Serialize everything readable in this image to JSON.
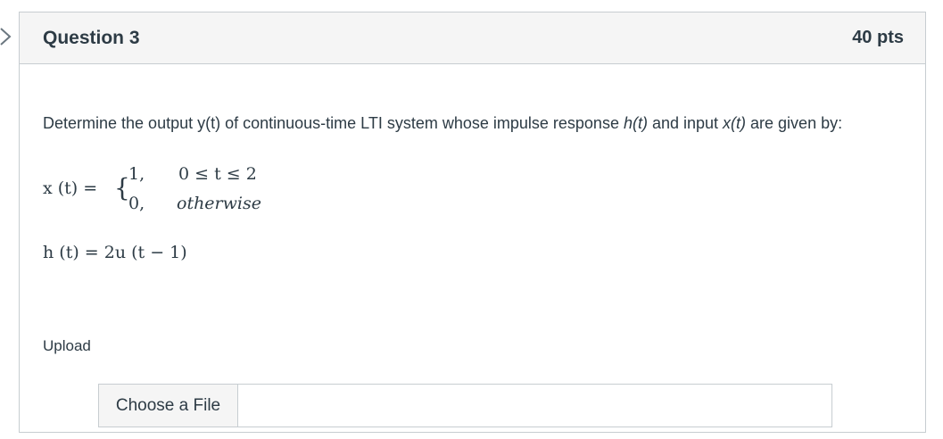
{
  "question": {
    "title": "Question 3",
    "points": "40 pts",
    "text_before_h": "Determine the output y(t) of continuous-time LTI system whose impulse response ",
    "h_symbol": "h(t)",
    "text_between": " and input ",
    "x_symbol": "x(t)",
    "text_after": " are given by:"
  },
  "equation_x": {
    "lhs": "x (t) = ",
    "brace": "{",
    "case1_value": "1,",
    "case1_condition": "0 ≤ t ≤ 2",
    "case2_value": "0,",
    "case2_condition": "otherwise"
  },
  "equation_h": "h (t) = 2u (t − 1)",
  "upload": {
    "label": "Upload",
    "button_label": "Choose a File",
    "file_name": ""
  },
  "icons": {
    "nav": "chevron-right-icon"
  }
}
